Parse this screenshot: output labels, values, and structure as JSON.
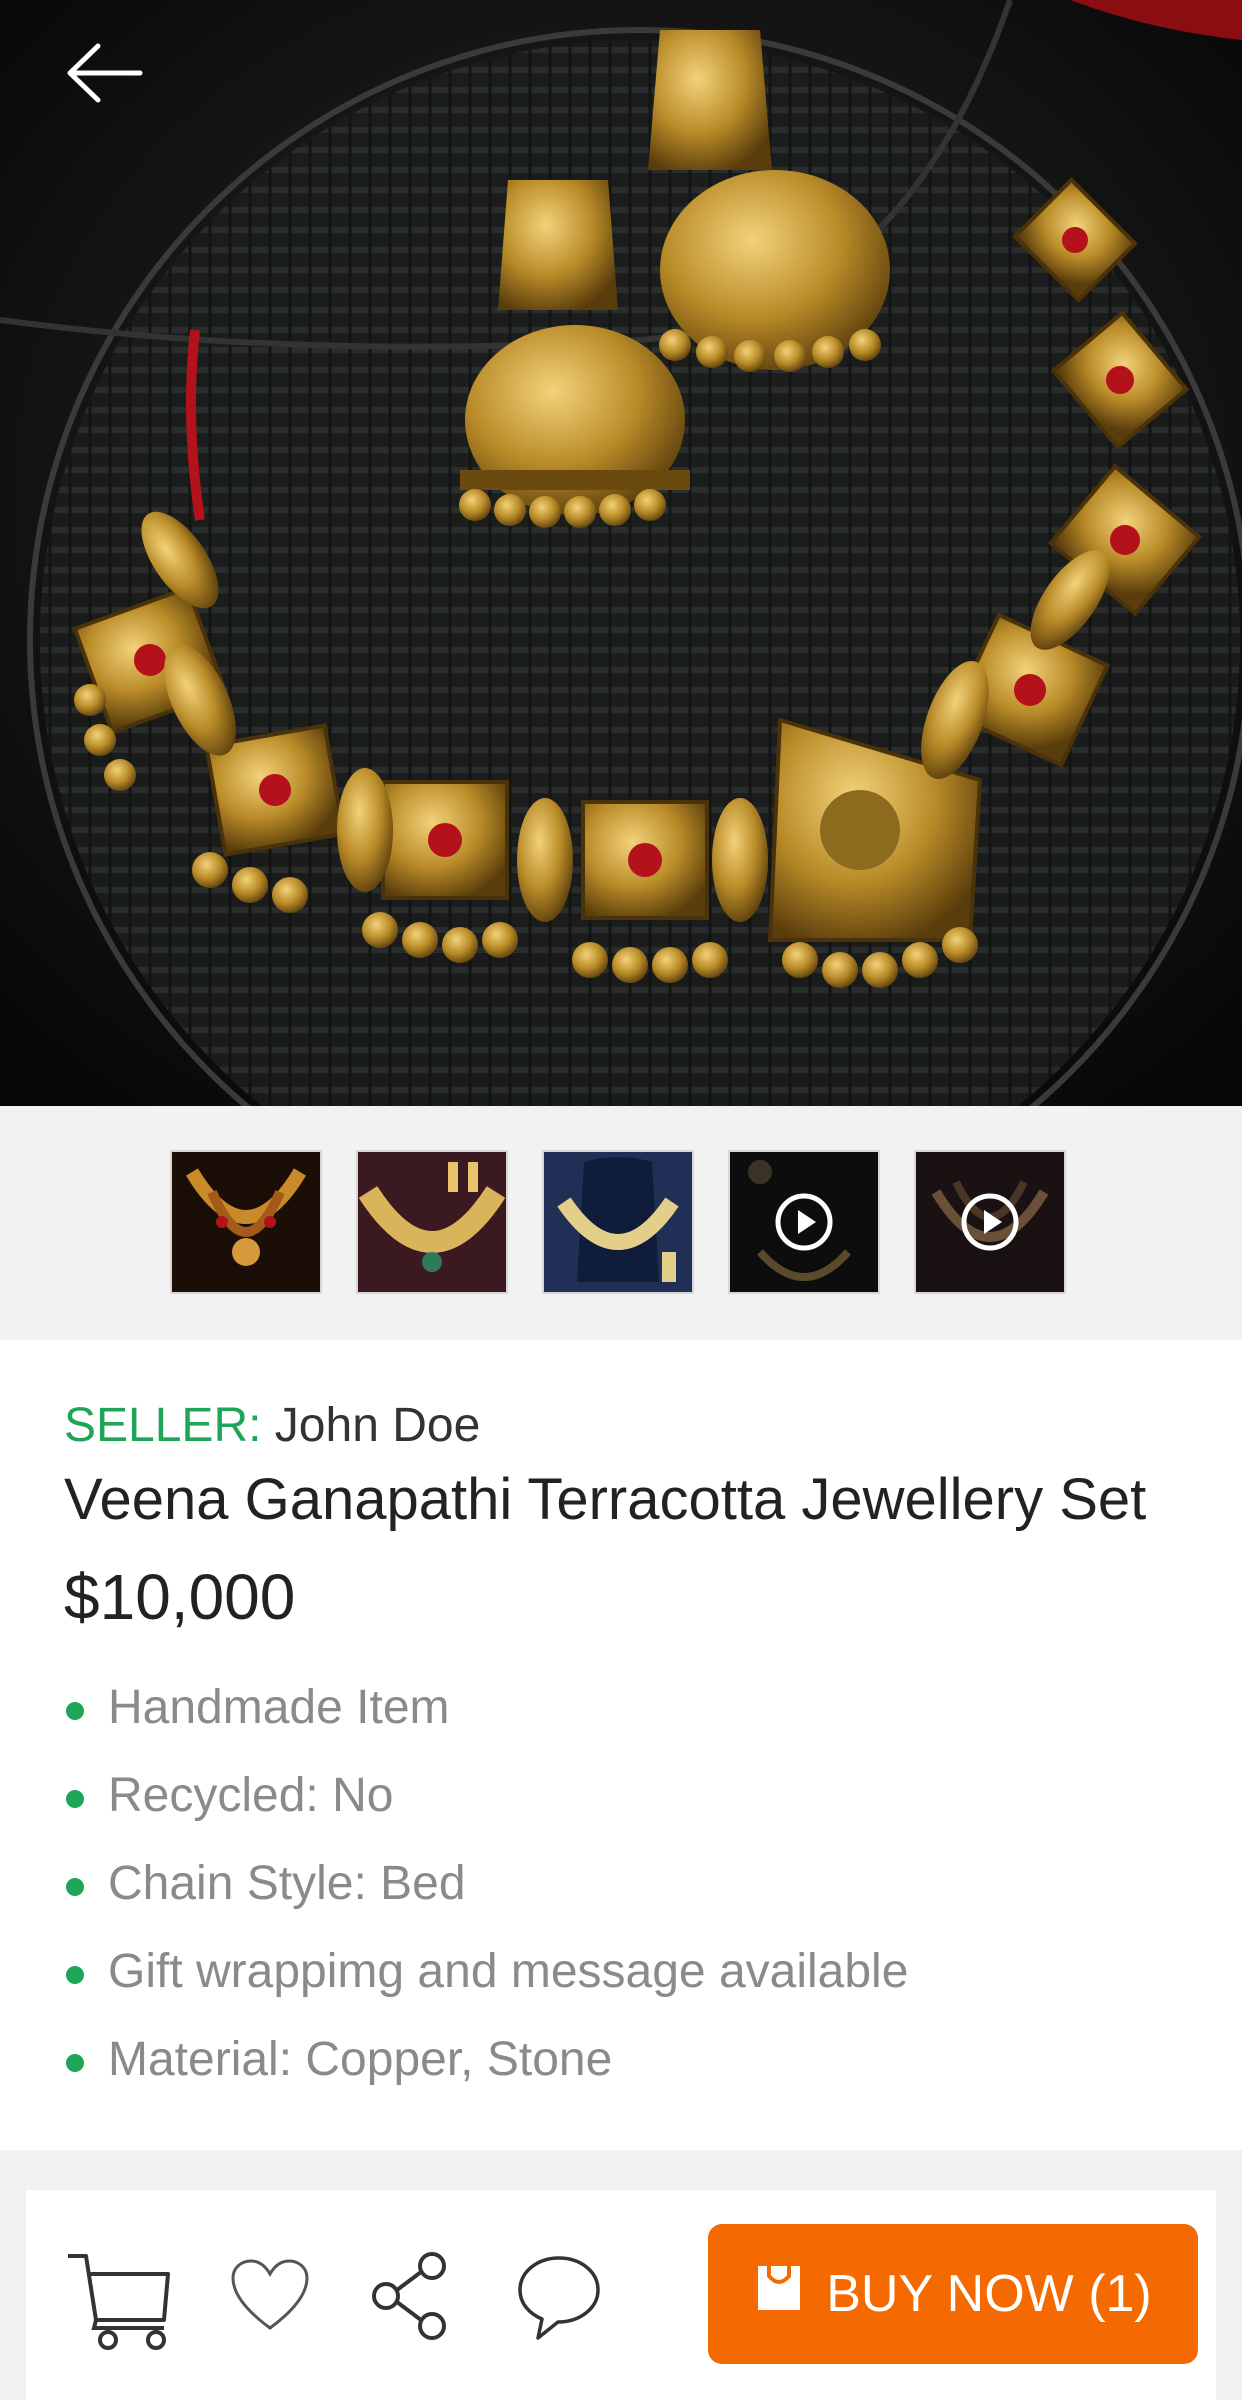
{
  "hero": {
    "image_name": "terracotta-jewellery-set-photo",
    "back_icon": "arrow-left-icon"
  },
  "thumbnails": [
    {
      "type": "image",
      "icon": "necklace-thumbnail"
    },
    {
      "type": "image",
      "icon": "necklace-thumbnail"
    },
    {
      "type": "image",
      "icon": "necklace-thumbnail"
    },
    {
      "type": "video",
      "icon": "play-icon"
    },
    {
      "type": "video",
      "icon": "play-icon"
    }
  ],
  "product": {
    "seller_label": "SELLER",
    "seller_sep": ":",
    "seller_name": "John Doe",
    "title": "Veena Ganapathi Terracotta Jewellery Set",
    "price": "$10,000",
    "features": [
      "Handmade Item",
      "Recycled: No",
      "Chain Style: Bed",
      "Gift wrappimg and message available",
      "Material: Copper, Stone"
    ]
  },
  "actions": {
    "cart_icon": "cart-icon",
    "favorite_icon": "heart-icon",
    "share_icon": "share-icon",
    "chat_icon": "chat-bubble-icon",
    "buy_label": "BUY NOW (1)"
  },
  "colors": {
    "accent_green": "#1fa557",
    "buy_orange": "#f46a00",
    "text_dark": "#222222",
    "text_muted": "#8a8a8a"
  }
}
